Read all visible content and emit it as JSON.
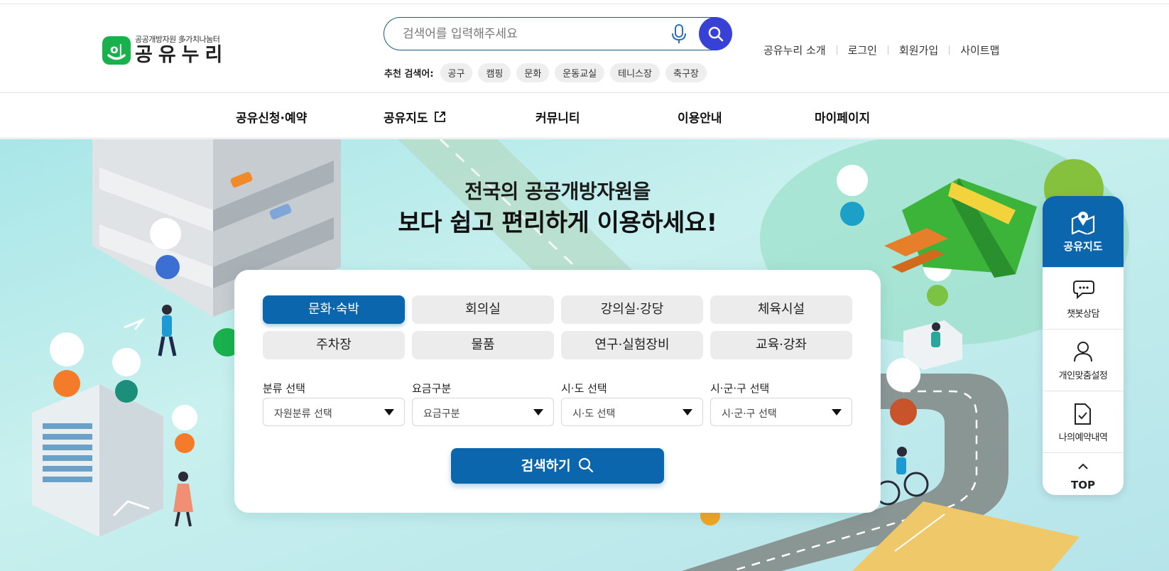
{
  "logo": {
    "subtitle": "공공개방자원 多가치나눔터",
    "name": "공유누리"
  },
  "search": {
    "placeholder": "검색어를 입력해주세요",
    "recommended_label": "추천 검색어:",
    "recommended": [
      "공구",
      "캠핑",
      "문화",
      "운동교실",
      "테니스장",
      "축구장"
    ]
  },
  "util_links": [
    "공유누리 소개",
    "로그인",
    "회원가입",
    "사이트맵"
  ],
  "nav": [
    "공유신청·예약",
    "공유지도",
    "커뮤니티",
    "이용안내",
    "마이페이지"
  ],
  "hero": {
    "line1": "전국의 공공개방자원을",
    "line2": "보다 쉽고 편리하게 이용하세요!"
  },
  "categories": [
    "문화·숙박",
    "회의실",
    "강의실·강당",
    "체육시설",
    "주차장",
    "물품",
    "연구·실험장비",
    "교육·강좌"
  ],
  "active_category": "문화·숙박",
  "filters": [
    {
      "label": "분류 선택",
      "value": "자원분류 선택"
    },
    {
      "label": "요금구분",
      "value": "요금구분"
    },
    {
      "label": "시·도 선택",
      "value": "시·도 선택"
    },
    {
      "label": "시·군·구 선택",
      "value": "시·군·구 선택"
    }
  ],
  "submit_label": "검색하기",
  "quick_menu": {
    "map": "공유지도",
    "chatbot": "챗봇상담",
    "settings": "개인맞춤설정",
    "reservations": "나의예약내역",
    "top": "TOP"
  },
  "colors": {
    "primary": "#0b66ad",
    "search_button": "#3741d6",
    "logo_green": "#19b14c",
    "hero_bg": "#b8e8ea"
  }
}
